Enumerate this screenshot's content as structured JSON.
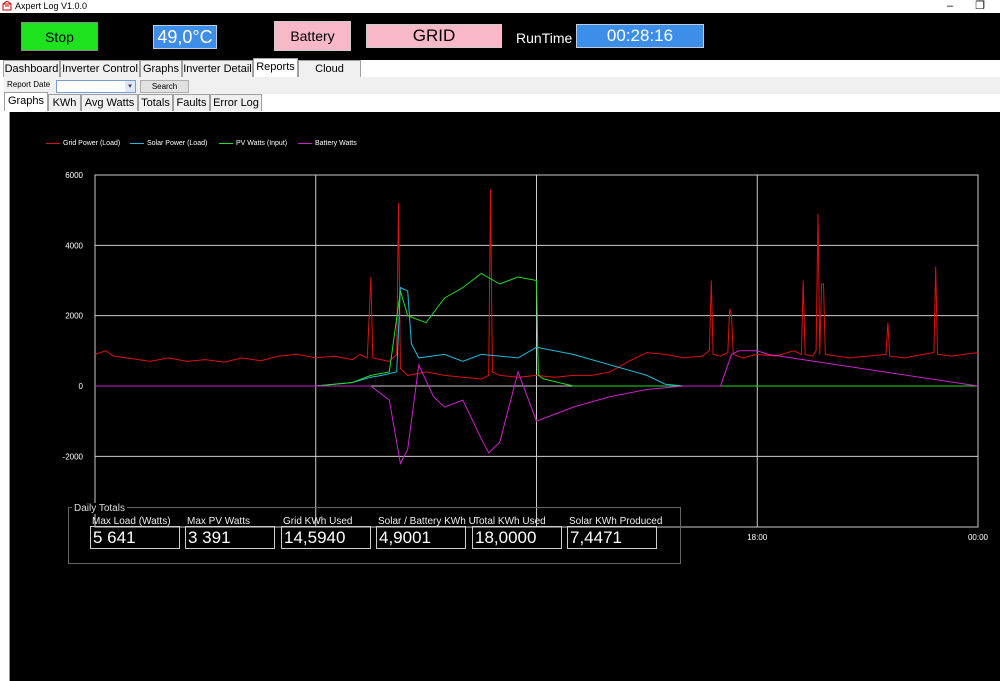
{
  "window": {
    "title": "Axpert Log V1.0.0"
  },
  "topbar": {
    "stop_label": "Stop",
    "temperature": "49,0°C",
    "battery_label": "Battery",
    "mode": "GRID",
    "runtime_label": "RunTime",
    "runtime": "00:28:16"
  },
  "main_tabs": [
    "Dashboard",
    "Inverter Control",
    "Graphs",
    "Inverter Detail",
    "Reports",
    "Cloud Config"
  ],
  "main_tabs_active": "Reports",
  "report": {
    "date_label": "Report Date",
    "date_value": "",
    "search_label": "Search"
  },
  "sub_tabs": [
    "Graphs",
    "KWh",
    "Avg Watts",
    "Totals",
    "Faults",
    "Error Log"
  ],
  "sub_tabs_active": "Graphs",
  "chart_data": {
    "type": "line",
    "legend": [
      "Grid Power (Load)",
      "Solar Power (Load)",
      "PV Watts (Input)",
      "Battery Watts"
    ],
    "legend_placement": "top-left",
    "colors": {
      "grid": "#dd1111",
      "solar": "#22bbdd",
      "pv": "#22dd22",
      "battery": "#cc22cc"
    },
    "ylim": [
      -3200,
      6000
    ],
    "yticks": [
      6000,
      4000,
      2000,
      0,
      -2000
    ],
    "xlim": [
      0,
      24
    ],
    "xticks": [
      {
        "h": 18,
        "label": "18:00"
      },
      {
        "h": 24,
        "label": "00:00"
      }
    ],
    "grid": true,
    "series": [
      {
        "name": "Grid Power (Load)",
        "key": "grid",
        "points": [
          [
            0,
            900
          ],
          [
            0.3,
            1000
          ],
          [
            0.5,
            850
          ],
          [
            1,
            780
          ],
          [
            1.5,
            700
          ],
          [
            2,
            800
          ],
          [
            2.5,
            700
          ],
          [
            3,
            750
          ],
          [
            3.5,
            680
          ],
          [
            4,
            800
          ],
          [
            4.5,
            720
          ],
          [
            5,
            850
          ],
          [
            5.5,
            900
          ],
          [
            6,
            800
          ],
          [
            6.5,
            850
          ],
          [
            7,
            750
          ],
          [
            7.2,
            900
          ],
          [
            7.4,
            800
          ],
          [
            7.5,
            3100
          ],
          [
            7.55,
            800
          ],
          [
            8,
            700
          ],
          [
            8.2,
            900
          ],
          [
            8.25,
            5200
          ],
          [
            8.3,
            500
          ],
          [
            8.5,
            300
          ],
          [
            9,
            400
          ],
          [
            9.5,
            300
          ],
          [
            10,
            250
          ],
          [
            10.5,
            200
          ],
          [
            10.7,
            300
          ],
          [
            10.75,
            5600
          ],
          [
            10.8,
            400
          ],
          [
            11,
            300
          ],
          [
            11.5,
            250
          ],
          [
            12,
            300
          ],
          [
            12.5,
            250
          ],
          [
            13,
            300
          ],
          [
            13.5,
            300
          ],
          [
            14,
            400
          ],
          [
            14.5,
            700
          ],
          [
            15,
            950
          ],
          [
            15.5,
            900
          ],
          [
            16,
            800
          ],
          [
            16.5,
            850
          ],
          [
            16.7,
            1000
          ],
          [
            16.75,
            3000
          ],
          [
            16.8,
            900
          ],
          [
            17,
            850
          ],
          [
            17.2,
            950
          ],
          [
            17.25,
            2200
          ],
          [
            17.3,
            2000
          ],
          [
            17.35,
            900
          ],
          [
            17.6,
            800
          ],
          [
            18,
            900
          ],
          [
            18.5,
            850
          ],
          [
            19,
            1000
          ],
          [
            19.2,
            900
          ],
          [
            19.25,
            3000
          ],
          [
            19.3,
            900
          ],
          [
            19.5,
            850
          ],
          [
            19.6,
            1000
          ],
          [
            19.65,
            4900
          ],
          [
            19.7,
            900
          ],
          [
            19.75,
            2900
          ],
          [
            19.8,
            2900
          ],
          [
            19.85,
            900
          ],
          [
            20.5,
            800
          ],
          [
            21,
            850
          ],
          [
            21.5,
            900
          ],
          [
            21.55,
            1800
          ],
          [
            21.6,
            850
          ],
          [
            22,
            800
          ],
          [
            22.5,
            900
          ],
          [
            22.8,
            950
          ],
          [
            22.85,
            3400
          ],
          [
            22.9,
            900
          ],
          [
            23.3,
            850
          ],
          [
            23.6,
            900
          ],
          [
            24,
            950
          ]
        ]
      },
      {
        "name": "Solar Power (Load)",
        "key": "solar",
        "points": [
          [
            0,
            0
          ],
          [
            6,
            0
          ],
          [
            7,
            100
          ],
          [
            7.5,
            250
          ],
          [
            7.8,
            300
          ],
          [
            8.2,
            400
          ],
          [
            8.3,
            2800
          ],
          [
            8.5,
            2700
          ],
          [
            8.6,
            1200
          ],
          [
            8.8,
            800
          ],
          [
            9.5,
            900
          ],
          [
            10,
            700
          ],
          [
            10.5,
            900
          ],
          [
            11,
            850
          ],
          [
            11.5,
            800
          ],
          [
            12,
            1100
          ],
          [
            13,
            900
          ],
          [
            15,
            300
          ],
          [
            15.5,
            50
          ],
          [
            16,
            0
          ],
          [
            24,
            0
          ]
        ]
      },
      {
        "name": "PV Watts (Input)",
        "key": "pv",
        "points": [
          [
            0,
            0
          ],
          [
            6,
            0
          ],
          [
            7,
            100
          ],
          [
            7.5,
            300
          ],
          [
            8,
            400
          ],
          [
            8.3,
            2700
          ],
          [
            8.5,
            2000
          ],
          [
            9,
            1800
          ],
          [
            9.5,
            2500
          ],
          [
            10,
            2800
          ],
          [
            10.5,
            3200
          ],
          [
            11,
            2900
          ],
          [
            11.5,
            3100
          ],
          [
            12,
            3000
          ],
          [
            12.05,
            300
          ],
          [
            12.2,
            200
          ],
          [
            13,
            0
          ],
          [
            24,
            0
          ]
        ]
      },
      {
        "name": "Battery Watts",
        "key": "battery",
        "points": [
          [
            0,
            0
          ],
          [
            7.5,
            0
          ],
          [
            8,
            -400
          ],
          [
            8.3,
            -2200
          ],
          [
            8.5,
            -1800
          ],
          [
            8.8,
            600
          ],
          [
            9.2,
            -300
          ],
          [
            9.5,
            -600
          ],
          [
            10,
            -400
          ],
          [
            10.5,
            -1500
          ],
          [
            10.7,
            -1900
          ],
          [
            11,
            -1600
          ],
          [
            11.5,
            400
          ],
          [
            12,
            -1000
          ],
          [
            13,
            -600
          ],
          [
            14,
            -300
          ],
          [
            15,
            -100
          ],
          [
            16,
            0
          ],
          [
            17,
            0
          ],
          [
            17.3,
            900
          ],
          [
            17.5,
            1000
          ],
          [
            18,
            1000
          ],
          [
            18.3,
            900
          ],
          [
            24,
            0
          ]
        ]
      }
    ]
  },
  "daily_totals": {
    "title": "Daily Totals",
    "items": [
      {
        "label": "Max Load (Watts)",
        "value": "5 641"
      },
      {
        "label": "Max PV Watts",
        "value": "3 391"
      },
      {
        "label": "Grid KWh Used",
        "value": "14,5940"
      },
      {
        "label": "Solar / Battery KWh U",
        "value": "4,9001"
      },
      {
        "label": "Total KWh Used",
        "value": "18,0000"
      },
      {
        "label": "Solar KWh Produced",
        "value": "7,4471"
      }
    ]
  }
}
